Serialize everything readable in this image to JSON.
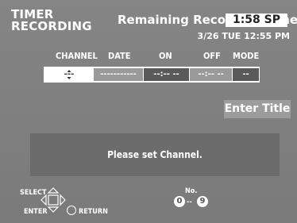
{
  "header": {
    "title_line1": "TIMER",
    "title_line2": "RECORDING",
    "remaining_label": "Remaining Recording Time",
    "remaining_time": "1:58 SP",
    "datetime": "3/26 TUE 12:55 PM"
  },
  "columns": [
    "CHANNEL",
    "DATE",
    "ON",
    "OFF",
    "MODE"
  ],
  "entry": {
    "channel": "---",
    "date": "-----------",
    "on": "--:-- --",
    "off": "--:-- --",
    "mode": "--"
  },
  "enter_title_label": "Enter Title",
  "message": "Please set Channel.",
  "guide": {
    "select": "SELECT",
    "enter": "ENTER",
    "return": "RETURN",
    "no_label": "No.",
    "num_from": "0",
    "num_sep": "--",
    "num_to": "9"
  }
}
